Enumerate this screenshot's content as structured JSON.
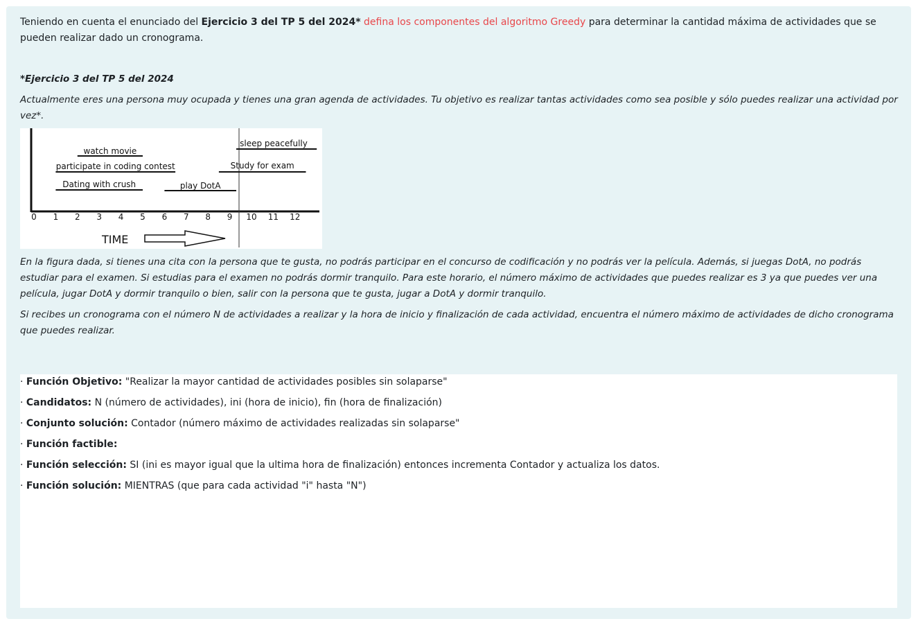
{
  "question": {
    "intro_pre": "Teniendo en cuenta el enunciado del ",
    "intro_bold": "Ejercicio 3 del TP 5 del 2024*",
    "intro_red": " defina los componentes del algoritmo Greedy ",
    "intro_post": " para determinar la cantidad máxima de actividades  que se pueden realizar dado un cronograma.",
    "exercise_title": "*Ejercicio 3 del TP 5 del 2024",
    "exercise_desc": "Actualmente eres una persona muy ocupada y tienes una gran agenda de actividades. Tu objetivo es realizar tantas actividades como sea posible y sólo puedes realizar una actividad por vez*.",
    "figure_text": "En la figura dada, si tienes una cita con la persona que te gusta, no podrás participar en el concurso de codificación y no podrás ver la película. Además, si juegas DotA, no podrás estudiar para el examen. Si estudias para el examen no podrás dormir tranquilo.  Para este horario, el número máximo de actividades que puedes realizar es 3 ya que puedes ver una película, jugar DotA y dormir tranquilo o bien, salir con la persona que te gusta, jugar a DotA y dormir tranquilo.",
    "schedule_text": "Si recibes un cronograma con el número N de actividades a realizar y la hora de inicio y finalización de cada actividad, encuentra el número máximo de actividades de dicho cronograma que puedes realizar."
  },
  "figure": {
    "activities": [
      {
        "label": "watch movie",
        "start": 2,
        "end": 5
      },
      {
        "label": "participate in coding contest",
        "start": 1,
        "end": 6.5
      },
      {
        "label": "Dating with crush",
        "start": 1,
        "end": 5
      },
      {
        "label": "play DotA",
        "start": 6,
        "end": 9.3
      },
      {
        "label": "sleep peacefully",
        "start": 9.3,
        "end": 13
      },
      {
        "label": "Study for exam",
        "start": 8.5,
        "end": 12.5
      }
    ],
    "ticks": [
      "0",
      "1",
      "2",
      "3",
      "4",
      "5",
      "6",
      "7",
      "8",
      "9",
      "10",
      "11",
      "12"
    ],
    "time_label": "TIME"
  },
  "answer": {
    "lines": [
      {
        "prefix": "· ",
        "label": "Función Objetivo:",
        "text": " \"Realizar la mayor cantidad de actividades posibles sin solaparse\""
      },
      {
        "prefix": "· ",
        "label": "Candidatos:",
        "text": " N (número de actividades), ini (hora de inicio), fin (hora de finalización)"
      },
      {
        "prefix": "· ",
        "label": "Conjunto solución:",
        "text": " Contador (número máximo de actividades realizadas sin solaparse\""
      },
      {
        "prefix": "· ",
        "label": "Función factible:",
        "text": ""
      },
      {
        "prefix": "· ",
        "label": "Función selección:",
        "text": " SI (ini es mayor igual que la ultima hora de finalización) entonces incrementa Contador y actualiza los datos."
      },
      {
        "prefix": "· ",
        "label": "Función solución:",
        "text": " MIENTRAS (que para cada actividad \"i\" hasta \"N\")"
      }
    ]
  }
}
